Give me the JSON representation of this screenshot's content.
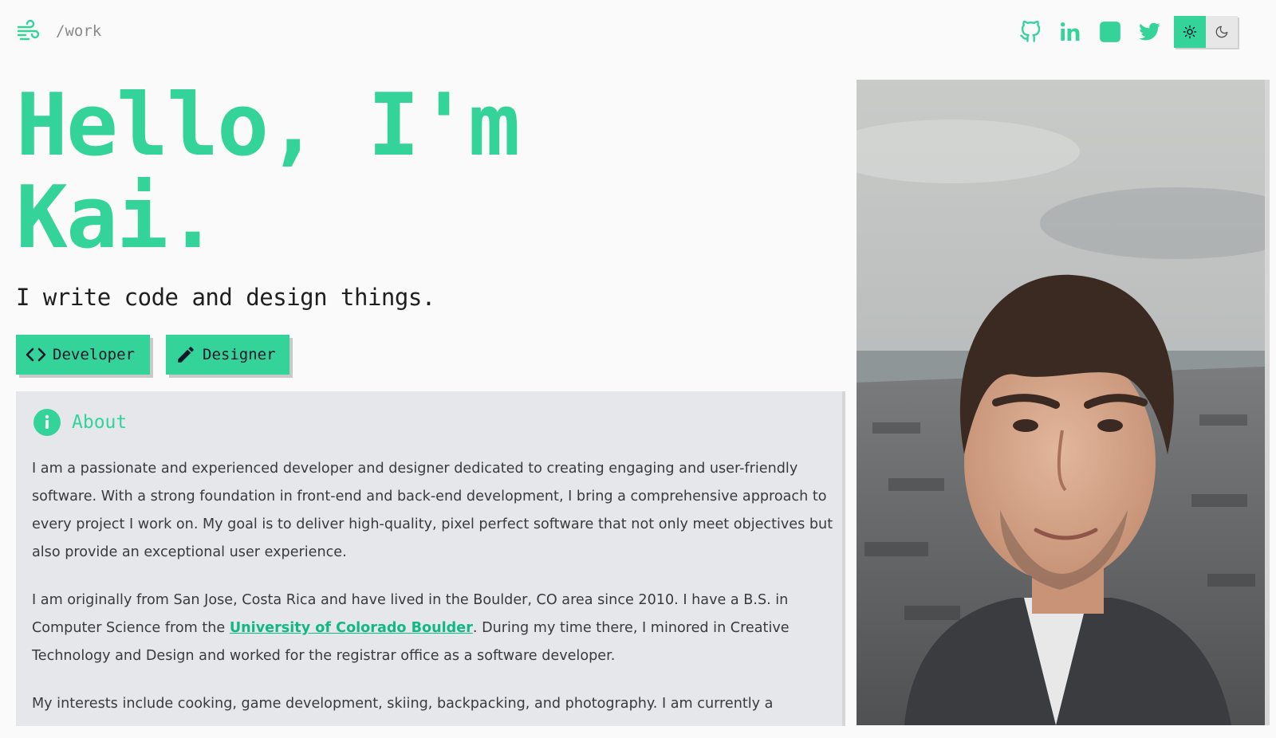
{
  "header": {
    "path": "/work",
    "socials": [
      {
        "name": "github-icon",
        "color": "#34d399"
      },
      {
        "name": "linkedin-icon",
        "color": "#34d399"
      },
      {
        "name": "square-icon",
        "color": "#34d399"
      },
      {
        "name": "twitter-icon",
        "color": "#34d399"
      }
    ],
    "theme": {
      "active": "light"
    }
  },
  "hero": {
    "title_line1": "Hello, I'm",
    "title_line2": "Kai.",
    "tagline": "I write code and design things.",
    "buttons": {
      "developer": "Developer",
      "designer": "Designer"
    }
  },
  "about": {
    "title": "About",
    "p1": "I am a passionate and experienced developer and designer dedicated to creating engaging and user-friendly software. With a strong foundation in front-end and back-end development, I bring a comprehensive approach to every project I work on. My goal is to deliver high-quality, pixel perfect software that not only meet objectives but also provide an exceptional user experience.",
    "p2_before": "I am originally from San Jose, Costa Rica and have lived in the Boulder, CO area since 2010. I have a B.S. in Computer Science from the ",
    "p2_link": "University of Colorado Boulder",
    "p2_after": ". During my time there, I minored in Creative Technology and Design and worked for the registrar office as a software developer.",
    "p3": "My interests include cooking, game development, skiing, backpacking, and photography. I am currently a"
  },
  "colors": {
    "accent": "#34d399",
    "background": "#fafafa",
    "card": "#e5e7eb"
  }
}
